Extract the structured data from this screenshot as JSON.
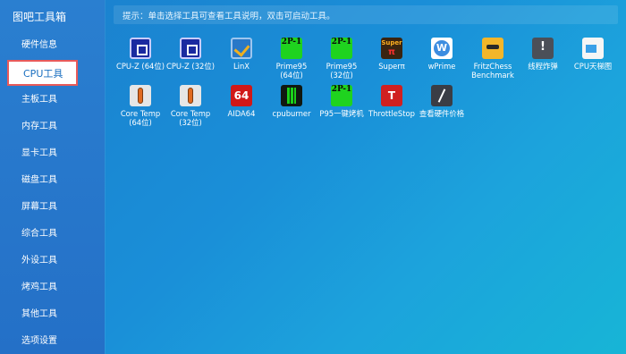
{
  "app": {
    "title": "图吧工具箱"
  },
  "hint": {
    "text": "提示：单击选择工具可查看工具说明，双击可启动工具。"
  },
  "sidebar": {
    "items": [
      {
        "label": "硬件信息",
        "active": false
      },
      {
        "label": "CPU工具",
        "active": true
      },
      {
        "label": "主板工具",
        "active": false
      },
      {
        "label": "内存工具",
        "active": false
      },
      {
        "label": "显卡工具",
        "active": false
      },
      {
        "label": "磁盘工具",
        "active": false
      },
      {
        "label": "屏幕工具",
        "active": false
      },
      {
        "label": "综合工具",
        "active": false
      },
      {
        "label": "外设工具",
        "active": false
      },
      {
        "label": "烤鸡工具",
        "active": false
      },
      {
        "label": "其他工具",
        "active": false
      },
      {
        "label": "选项设置",
        "active": false
      }
    ]
  },
  "tools": {
    "row1": [
      {
        "label": "CPU-Z (64位)",
        "icon": "cpu-z-icon"
      },
      {
        "label": "CPU-Z (32位)",
        "icon": "cpu-z-icon"
      },
      {
        "label": "LinX",
        "icon": "linx-icon"
      },
      {
        "label": "Prime95\n(64位)",
        "icon": "prime95-icon",
        "glyph": "2P-1"
      },
      {
        "label": "Prime95\n(32位)",
        "icon": "prime95-icon",
        "glyph": "2P-1"
      },
      {
        "label": "Superπ",
        "icon": "superpi-icon"
      },
      {
        "label": "wPrime",
        "icon": "wprime-icon"
      },
      {
        "label": "FritzChess\nBenchmark",
        "icon": "fritzchess-icon"
      },
      {
        "label": "线程炸弹",
        "icon": "warning-icon"
      },
      {
        "label": "CPU天梯图",
        "icon": "document-image-icon"
      }
    ],
    "row2": [
      {
        "label": "Core Temp\n(64位)",
        "icon": "core-temp-icon"
      },
      {
        "label": "Core Temp\n(32位)",
        "icon": "core-temp-icon"
      },
      {
        "label": "AIDA64",
        "icon": "aida64-icon",
        "glyph": "64"
      },
      {
        "label": "cpuburner",
        "icon": "cpuburner-icon"
      },
      {
        "label": "P95一键烤机",
        "icon": "prime95-icon",
        "glyph": "2P-1"
      },
      {
        "label": "ThrottleStop",
        "icon": "throttlestop-icon",
        "glyph": "T"
      },
      {
        "label": "查看硬件价格",
        "icon": "price-gauge-icon"
      }
    ]
  }
}
